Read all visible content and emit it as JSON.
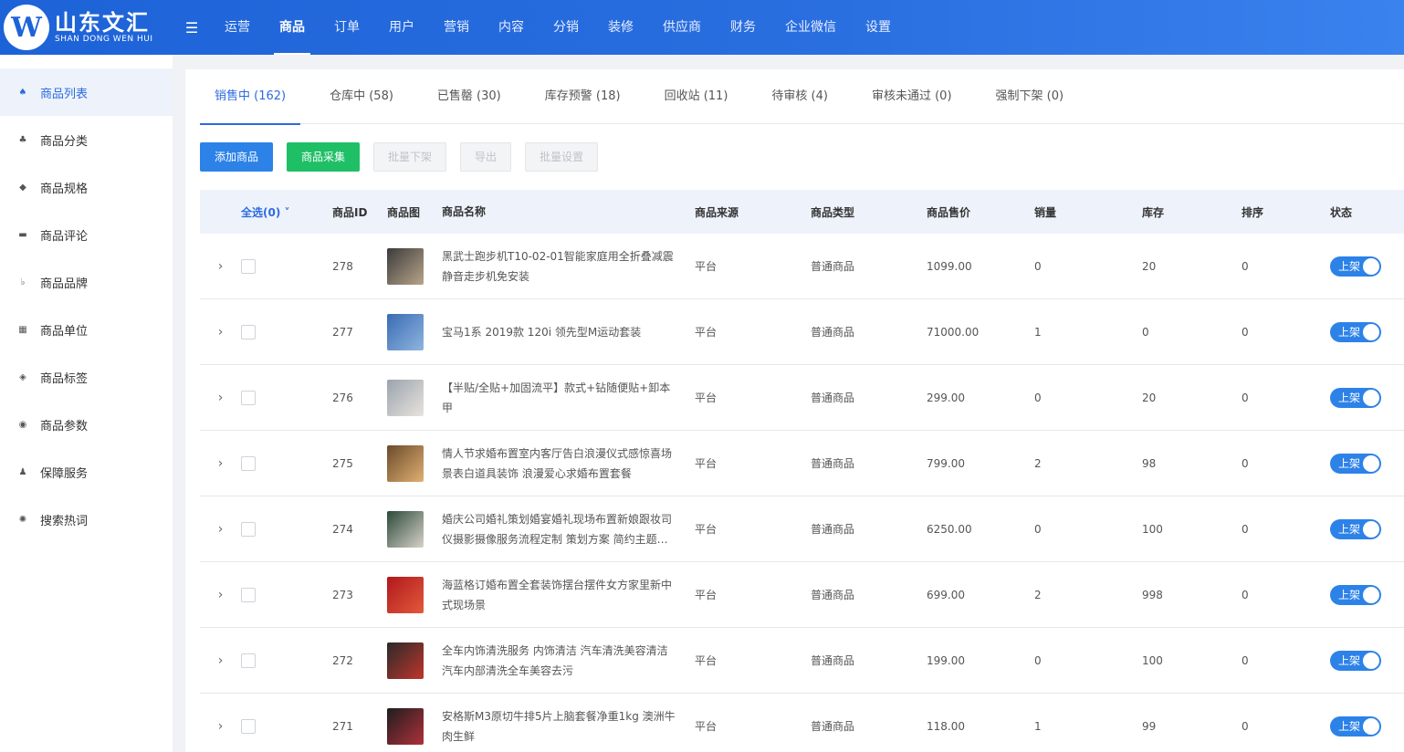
{
  "logo": {
    "mark": "W",
    "cn": "山东文汇",
    "en": "SHAN DONG WEN HUI"
  },
  "nav": [
    "运营",
    "商品",
    "订单",
    "用户",
    "营销",
    "内容",
    "分销",
    "装修",
    "供应商",
    "财务",
    "企业微信",
    "设置"
  ],
  "nav_active": 1,
  "sidebar": [
    {
      "label": "商品列表",
      "icon": "basket-icon",
      "glyph": "♠"
    },
    {
      "label": "商品分类",
      "icon": "category-icon",
      "glyph": "♣"
    },
    {
      "label": "商品规格",
      "icon": "cube-icon",
      "glyph": "◆"
    },
    {
      "label": "商品评论",
      "icon": "comment-icon",
      "glyph": "▬"
    },
    {
      "label": "商品品牌",
      "icon": "brand-icon",
      "glyph": "♭"
    },
    {
      "label": "商品单位",
      "icon": "grid-icon",
      "glyph": "▦"
    },
    {
      "label": "商品标签",
      "icon": "tag-icon",
      "glyph": "◈"
    },
    {
      "label": "商品参数",
      "icon": "eye-icon",
      "glyph": "◉"
    },
    {
      "label": "保障服务",
      "icon": "service-icon",
      "glyph": "♟"
    },
    {
      "label": "搜索热词",
      "icon": "hot-search-icon",
      "glyph": "✺"
    }
  ],
  "tabs": [
    "销售中 (162)",
    "仓库中 (58)",
    "已售罄 (30)",
    "库存预警 (18)",
    "回收站 (11)",
    "待审核 (4)",
    "审核未通过 (0)",
    "强制下架 (0)"
  ],
  "toolbar": {
    "add": "添加商品",
    "collect": "商品采集",
    "batch_off": "批量下架",
    "export": "导出",
    "batch_set": "批量设置"
  },
  "columns": {
    "select_all": "全选(0)",
    "id": "商品ID",
    "image": "商品图",
    "name": "商品名称",
    "source": "商品来源",
    "type": "商品类型",
    "price": "商品售价",
    "sales": "销量",
    "stock": "库存",
    "sort": "排序",
    "status": "状态"
  },
  "status_on_label": "上架",
  "rows": [
    {
      "id": "278",
      "name": "黑武士跑步机T10-02-01智能家庭用全折叠减震静音走步机免安装",
      "source": "平台",
      "type": "普通商品",
      "price": "1099.00",
      "sales": "0",
      "stock": "20",
      "sort": "0",
      "thumb_colors": [
        "#3b3b3b",
        "#b9a48a"
      ]
    },
    {
      "id": "277",
      "name": "宝马1系 2019款 120i 领先型M运动套装",
      "source": "平台",
      "type": "普通商品",
      "price": "71000.00",
      "sales": "1",
      "stock": "0",
      "sort": "0",
      "thumb_colors": [
        "#3a6bb5",
        "#8fb5de"
      ]
    },
    {
      "id": "276",
      "name": "【半贴/全贴+加固流平】款式+钻随便贴+卸本甲",
      "source": "平台",
      "type": "普通商品",
      "price": "299.00",
      "sales": "0",
      "stock": "20",
      "sort": "0",
      "thumb_colors": [
        "#9aa3ad",
        "#e8e4de"
      ]
    },
    {
      "id": "275",
      "name": "情人节求婚布置室内客厅告白浪漫仪式感惊喜场景表白道具装饰 浪漫爱心求婚布置套餐",
      "source": "平台",
      "type": "普通商品",
      "price": "799.00",
      "sales": "2",
      "stock": "98",
      "sort": "0",
      "thumb_colors": [
        "#6b4a2c",
        "#e0b070"
      ]
    },
    {
      "id": "274",
      "name": "婚庆公司婚礼策划婚宴婚礼现场布置新娘跟妆司仪摄影摄像服务流程定制 策划方案 简约主题婚礼",
      "source": "平台",
      "type": "普通商品",
      "price": "6250.00",
      "sales": "0",
      "stock": "100",
      "sort": "0",
      "thumb_colors": [
        "#2b4a3a",
        "#d8d2c8"
      ]
    },
    {
      "id": "273",
      "name": "海蓝格订婚布置全套装饰摆台摆件女方家里新中式现场景",
      "source": "平台",
      "type": "普通商品",
      "price": "699.00",
      "sales": "2",
      "stock": "998",
      "sort": "0",
      "thumb_colors": [
        "#b0181d",
        "#e25a3a"
      ]
    },
    {
      "id": "272",
      "name": "全车内饰清洗服务 内饰清洁 汽车清洗美容清洁汽车内部清洗全车美容去污",
      "source": "平台",
      "type": "普通商品",
      "price": "199.00",
      "sales": "0",
      "stock": "100",
      "sort": "0",
      "thumb_colors": [
        "#2a2a2a",
        "#c0352b"
      ]
    },
    {
      "id": "271",
      "name": "安格斯M3原切牛排5片上脑套餐净重1kg 澳洲牛肉生鲜",
      "source": "平台",
      "type": "普通商品",
      "price": "118.00",
      "sales": "1",
      "stock": "99",
      "sort": "0",
      "thumb_colors": [
        "#1e1e1e",
        "#b0303a"
      ]
    }
  ]
}
